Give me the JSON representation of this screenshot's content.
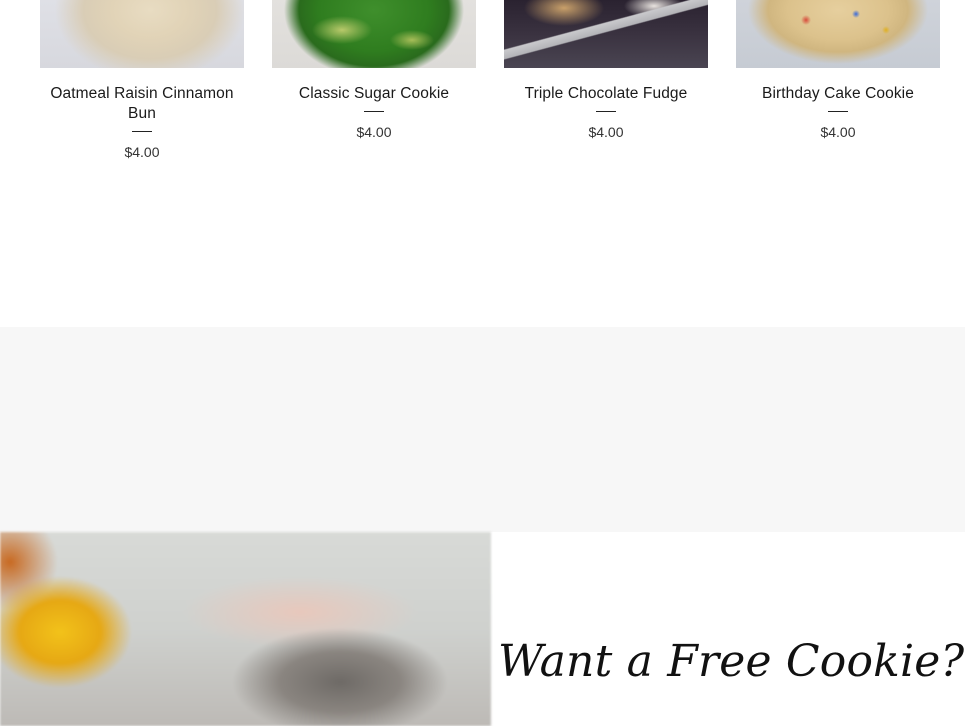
{
  "products": [
    {
      "name": "Oatmeal Raisin Cinnamon Bun",
      "price": "$4.00",
      "image": "oatmeal-raisin-cookie-photo"
    },
    {
      "name": "Classic Sugar Cookie",
      "price": "$4.00",
      "image": "green-sugar-cookie-photo"
    },
    {
      "name": "Triple Chocolate Fudge",
      "price": "$4.00",
      "image": "chocolate-fudge-cookie-photo"
    },
    {
      "name": "Birthday Cake Cookie",
      "price": "$4.00",
      "image": "birthday-cake-cookie-photo"
    }
  ],
  "promo": {
    "heading": "Want a Free Cookie?",
    "image": "blurred-cookie-photo"
  },
  "colors": {
    "band": "#f7f7f7",
    "background": "#ffffff",
    "text": "#1a1a1a"
  }
}
